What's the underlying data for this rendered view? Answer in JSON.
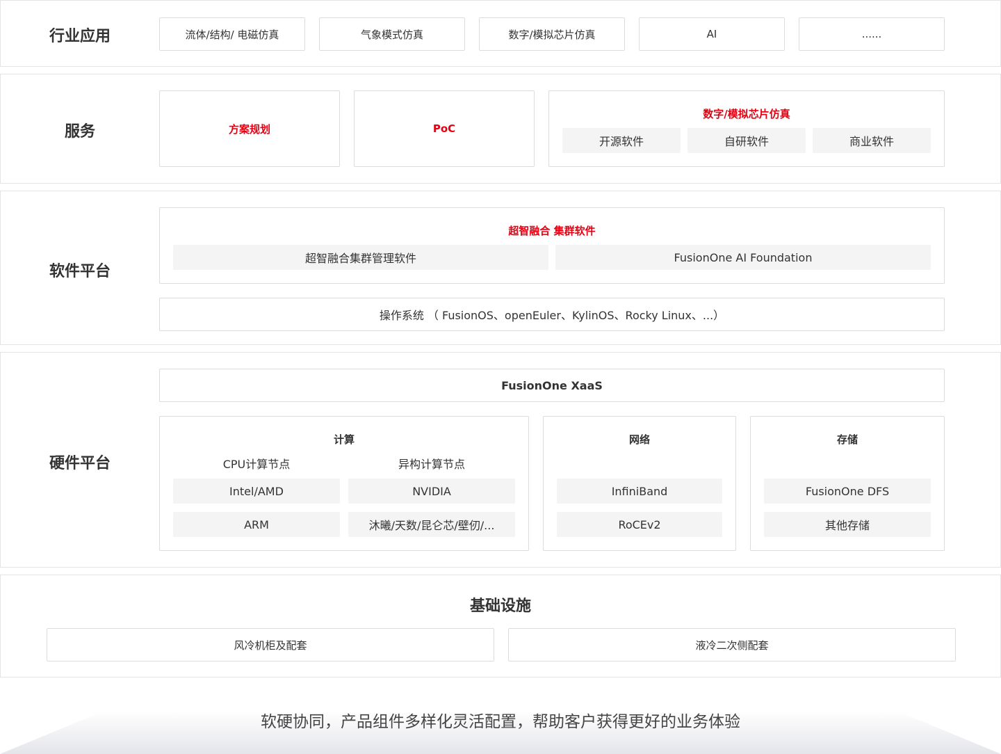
{
  "industry": {
    "title": "行业应用",
    "items": [
      "流体/结构/ 电磁仿真",
      "气象模式仿真",
      "数字/模拟芯片仿真",
      "AI",
      "......"
    ]
  },
  "services": {
    "title": "服务",
    "planning": "方案规划",
    "poc": "PoC",
    "chip_sim": {
      "title": "数字/模拟芯片仿真",
      "items": [
        "开源软件",
        "自研软件",
        "商业软件"
      ]
    }
  },
  "software": {
    "title": "软件平台",
    "cluster": {
      "title": "超智融合 集群软件",
      "items": [
        "超智融合集群管理软件",
        "FusionOne AI Foundation"
      ]
    },
    "os": "操作系统  （ FusionOS、openEuler、KylinOS、Rocky Linux、...）"
  },
  "hardware": {
    "title": "硬件平台",
    "xaas": "FusionOne XaaS",
    "compute": {
      "title": "计算",
      "cpu_label": "CPU计算节点",
      "hetero_label": "异构计算节点",
      "cpu_items": [
        "Intel/AMD",
        "ARM"
      ],
      "hetero_items": [
        "NVIDIA",
        "沐曦/天数/昆仑芯/壁仞/..."
      ]
    },
    "network": {
      "title": "网络",
      "items": [
        "InfiniBand",
        "RoCEv2"
      ]
    },
    "storage": {
      "title": "存储",
      "items": [
        "FusionOne DFS",
        "其他存储"
      ]
    }
  },
  "infrastructure": {
    "title": "基础设施",
    "items": [
      "风冷机柜及配套",
      "液冷二次侧配套"
    ]
  },
  "footer": {
    "slogan": "软硬协同，产品组件多样化灵活配置，帮助客户获得更好的业务体验"
  },
  "colors": {
    "accent_red": "#e60012",
    "chip_bg": "#f4f4f5",
    "border": "#dcdcdc"
  }
}
